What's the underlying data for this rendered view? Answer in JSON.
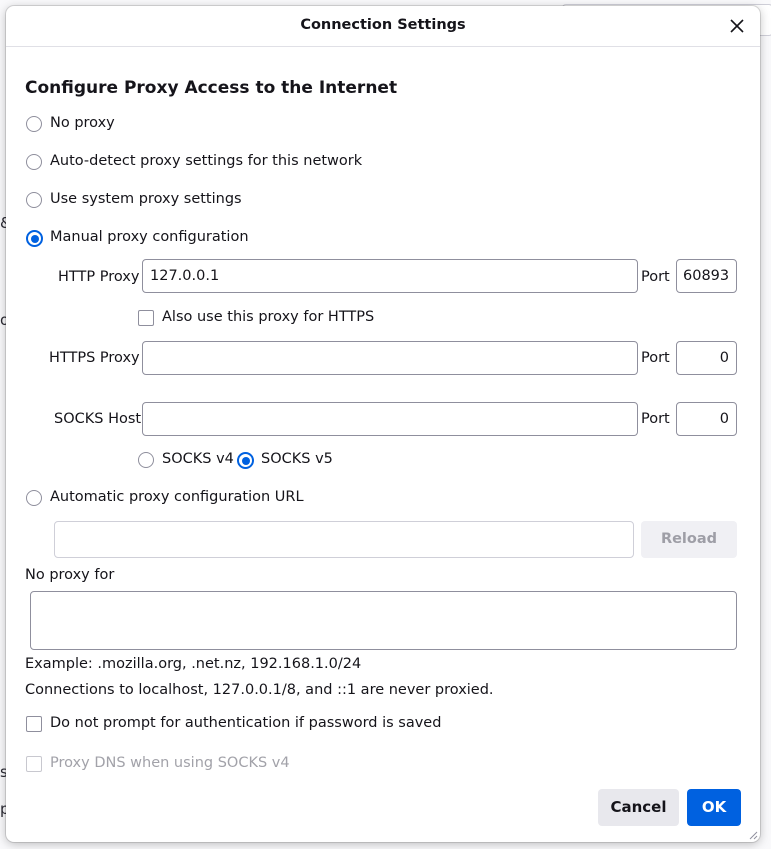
{
  "dialog": {
    "title": "Connection Settings"
  },
  "heading": "Configure Proxy Access to the Internet",
  "proxy_modes": [
    {
      "label": "No proxy",
      "checked": false
    },
    {
      "label": "Auto-detect proxy settings for this network",
      "checked": false
    },
    {
      "label": "Use system proxy settings",
      "checked": false
    },
    {
      "label": "Manual proxy configuration",
      "checked": true
    }
  ],
  "http_proxy": {
    "label": "HTTP Proxy",
    "value": "127.0.0.1",
    "port_label": "Port",
    "port": "60893"
  },
  "also_https": {
    "label": "Also use this proxy for HTTPS",
    "checked": false
  },
  "https_proxy": {
    "label": "HTTPS Proxy",
    "value": "",
    "port_label": "Port",
    "port": "0"
  },
  "socks": {
    "label": "SOCKS Host",
    "value": "",
    "port_label": "Port",
    "port": "0",
    "v4_label": "SOCKS v4",
    "v5_label": "SOCKS v5",
    "selected": "v5"
  },
  "auto_url": {
    "label": "Automatic proxy configuration URL",
    "value": "",
    "reload_label": "Reload",
    "checked": false
  },
  "no_proxy": {
    "label": "No proxy for",
    "value": "",
    "example": "Example: .mozilla.org, .net.nz, 192.168.1.0/24",
    "note": "Connections to localhost, 127.0.0.1/8, and ::1 are never proxied."
  },
  "no_prompt_auth": {
    "label": "Do not prompt for authentication if password is saved",
    "checked": false
  },
  "proxy_dns": {
    "label": "Proxy DNS when using SOCKS v4",
    "checked": false,
    "disabled": true
  },
  "buttons": {
    "cancel": "Cancel",
    "ok": "OK"
  },
  "colors": {
    "accent": "#0061e0",
    "border": "#8f8f9d",
    "text": "#15141a"
  },
  "background_fragments": [
    "&",
    "o",
    "s",
    "p"
  ]
}
